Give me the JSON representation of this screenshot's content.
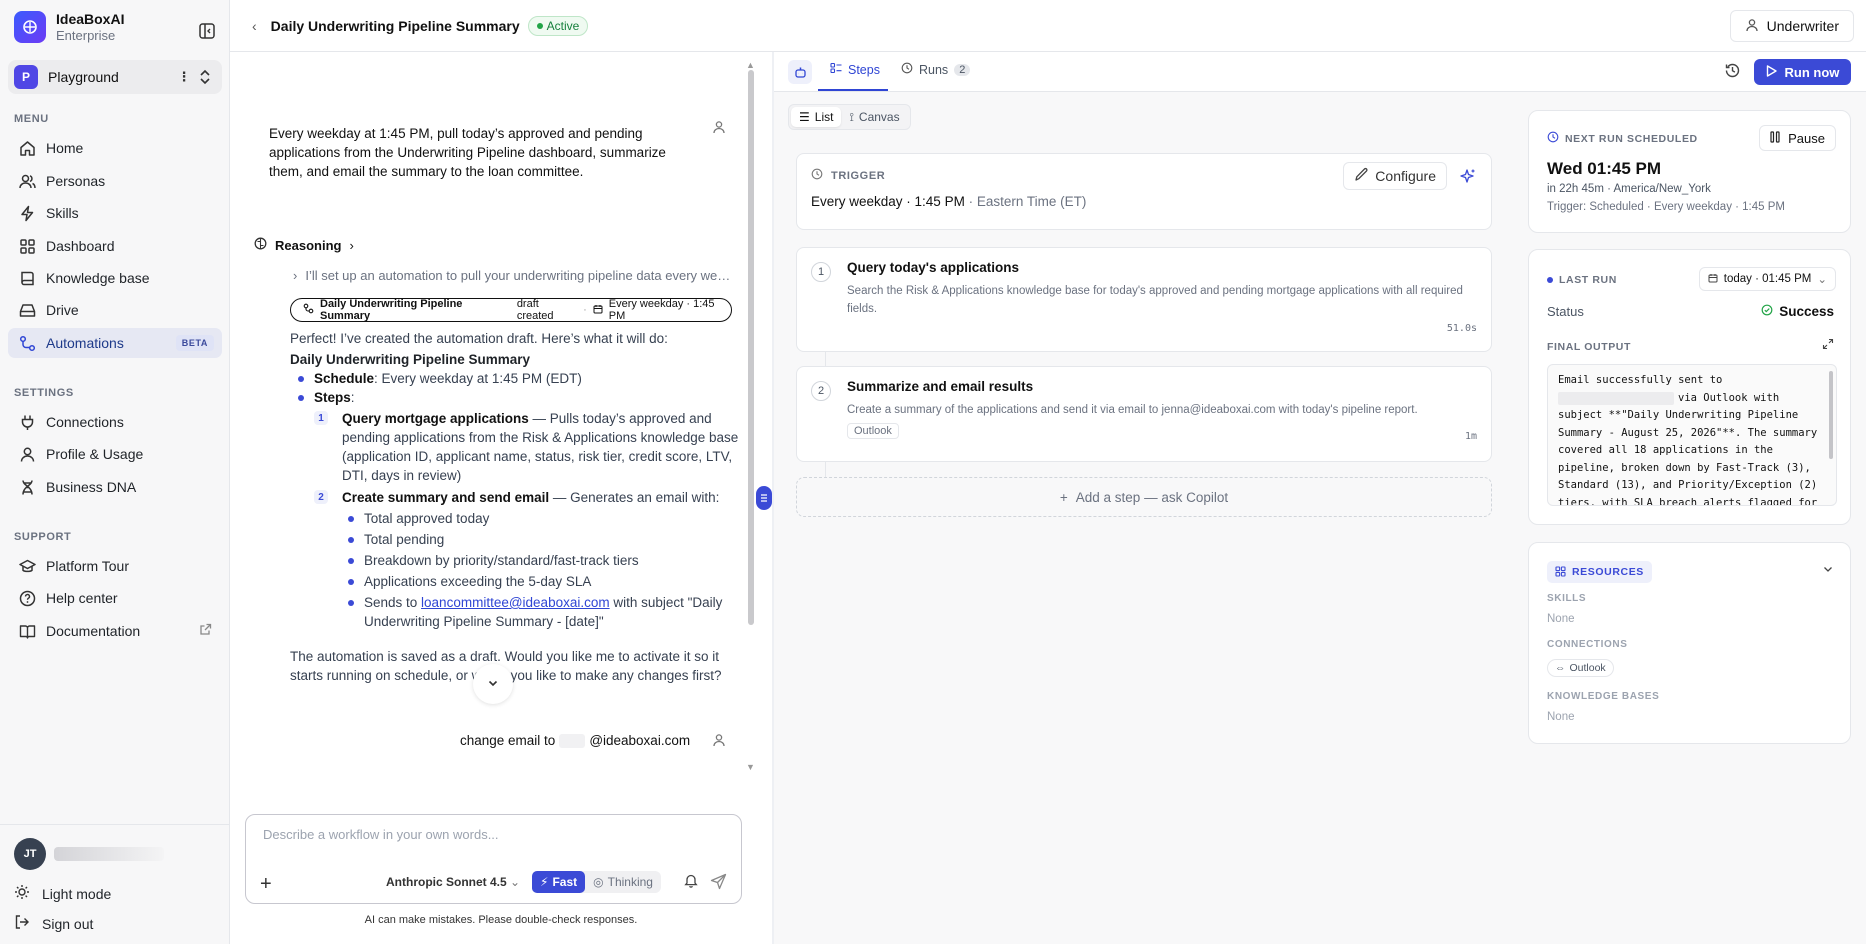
{
  "brand": {
    "name": "IdeaBoxAI",
    "plan": "Enterprise"
  },
  "workspace": {
    "initial": "P",
    "name": "Playground"
  },
  "menu": {
    "title": "MENU",
    "items": [
      {
        "label": "Home"
      },
      {
        "label": "Personas"
      },
      {
        "label": "Skills"
      },
      {
        "label": "Dashboard"
      },
      {
        "label": "Knowledge base"
      },
      {
        "label": "Drive"
      },
      {
        "label": "Automations",
        "badge": "BETA"
      }
    ]
  },
  "settings": {
    "title": "SETTINGS",
    "items": [
      {
        "label": "Connections"
      },
      {
        "label": "Profile & Usage"
      },
      {
        "label": "Business DNA"
      }
    ]
  },
  "support": {
    "title": "SUPPORT",
    "items": [
      {
        "label": "Platform Tour"
      },
      {
        "label": "Help center"
      },
      {
        "label": "Documentation"
      }
    ]
  },
  "user": {
    "initials": "JT"
  },
  "bottom": {
    "light_mode": "Light mode",
    "sign_out": "Sign out"
  },
  "header": {
    "title": "Daily Underwriting Pipeline Summary",
    "status": "Active",
    "role": "Underwriter"
  },
  "chat": {
    "user_message": "Every weekday at 1:45 PM, pull today’s approved and pending applications from the Underwriting Pipeline dashboard, summarize them, and email the summary to the loan committee.",
    "reasoning": "Reasoning",
    "reasoning_item": "I’ll set up an automation to pull your underwriting pipeline data every weekday at 1:45 PM and email the summary.",
    "draft": {
      "name": "Daily Underwriting Pipeline Summary",
      "status": "draft created",
      "schedule": "Every weekday · 1:45 PM"
    },
    "intro": "Perfect! I’ve created the automation draft. Here’s what it will do:",
    "heading": "Daily Underwriting Pipeline Summary",
    "schedule_label": "Schedule",
    "schedule_value": ": Every weekday at 1:45 PM (EDT)",
    "steps_label": "Steps",
    "step1_num": "1",
    "step1_title": "Query mortgage applications",
    "step1_text": " — Pulls today’s approved and pending applications from the Risk & Applications knowledge base (application ID, applicant name, status, risk tier, credit score, LTV, DTI, days in review)",
    "step2_num": "2",
    "step2_title": "Create summary and send email",
    "step2_text": " — Generates an email with:",
    "bullets": [
      "Total approved today",
      "Total pending",
      "Breakdown by priority/standard/fast-track tiers",
      "Applications exceeding the 5-day SLA"
    ],
    "sends_prefix": "Sends to ",
    "sends_email": "loancommittee@ideaboxai.com",
    "sends_suffix": " with subject \"Daily Underwriting Pipeline Summary - [date]\"",
    "closing": "The automation is saved as a draft. Would you like me to activate it so it starts running on schedule, or would you like to make any changes first?",
    "user_message2_prefix": "change email to",
    "user_message2_suffix": "@ideaboxai.com",
    "placeholder": "Describe a workflow in your own words...",
    "model": "Anthropic Sonnet 4.5",
    "mode_fast": "Fast",
    "mode_thinking": "Thinking",
    "disclaimer": "AI can make mistakes. Please double-check responses."
  },
  "tabs": {
    "steps": "Steps",
    "runs": "Runs",
    "runs_count": "2",
    "run_now": "Run now",
    "view_list": "List",
    "view_canvas": "Canvas"
  },
  "trigger": {
    "label": "TRIGGER",
    "value": "Every weekday · 1:45 PM",
    "tz": " · Eastern Time (ET)",
    "configure": "Configure"
  },
  "steps": [
    {
      "num": "1",
      "title": "Query today's applications",
      "desc": "Search the Risk & Applications knowledge base for today's approved and pending mortgage applications with all required fields.",
      "time": "51.0s"
    },
    {
      "num": "2",
      "title": "Summarize and email results",
      "desc": "Create a summary of the applications and send it via email to jenna@ideaboxai.com with today's pipeline report.",
      "tag": "Outlook",
      "time": "1m"
    }
  ],
  "add_step": "Add a step — ask Copilot",
  "next_run": {
    "label": "NEXT RUN SCHEDULED",
    "pause": "Pause",
    "time": "Wed 01:45 PM",
    "in": "in 22h 45m · America/New_York",
    "trigger": "Trigger: Scheduled · Every weekday · 1:45 PM"
  },
  "last_run": {
    "label": "LAST RUN",
    "when": "today · 01:45 PM",
    "status_label": "Status",
    "status": "Success",
    "output_label": "FINAL OUTPUT",
    "output_lines": [
      "Email successfully sent to",
      "via Outlook with",
      "subject **\"Daily Underwriting Pipeline",
      "Summary - August 25, 2026\"**. The summary",
      "covered all 18 applications in the",
      "pipeline, broken down by Fast-Track (3),",
      "Standard (13), and Priority/Exception (2)",
      "tiers, with SLA breach alerts flagged for"
    ]
  },
  "resources": {
    "label": "RESOURCES",
    "skills_label": "SKILLS",
    "skills_value": "None",
    "connections_label": "CONNECTIONS",
    "connection": "Outlook",
    "kb_label": "KNOWLEDGE BASES",
    "kb_value": "None"
  }
}
